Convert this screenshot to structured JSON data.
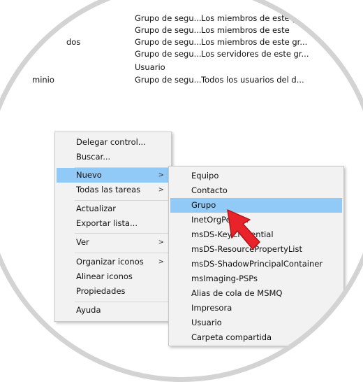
{
  "background_rows": [
    {
      "c1": "",
      "c2": "Grupo de segu...",
      "c3": "Los miembros de este gr..."
    },
    {
      "c1": "",
      "c2": "Grupo de segu...",
      "c3": "Los miembros de este"
    },
    {
      "c1": "dos",
      "c2": "Grupo de segu...",
      "c3": "Los miembros de este gr..."
    },
    {
      "c1": "",
      "c2": "Grupo de segu...",
      "c3": "Los servidores de este gr..."
    },
    {
      "c1": "",
      "c2": "Usuario",
      "c3": ""
    },
    {
      "c1": "minio",
      "c2": "Grupo de segu...",
      "c3": "Todos los usuarios del d..."
    }
  ],
  "context_menu": {
    "items": [
      {
        "label": "Delegar control...",
        "arrow": ""
      },
      {
        "label": "Buscar...",
        "arrow": ""
      },
      {
        "label": "Nuevo",
        "arrow": ">"
      },
      {
        "label": "Todas las tareas",
        "arrow": ">"
      },
      {
        "label": "Actualizar",
        "arrow": ""
      },
      {
        "label": "Exportar lista...",
        "arrow": ""
      },
      {
        "label": "Ver",
        "arrow": ">"
      },
      {
        "label": "Organizar iconos",
        "arrow": ">"
      },
      {
        "label": "Alinear iconos",
        "arrow": ""
      },
      {
        "label": "Propiedades",
        "arrow": ""
      },
      {
        "label": "Ayuda",
        "arrow": ""
      }
    ]
  },
  "submenu": {
    "items": [
      "Equipo",
      "Contacto",
      "Grupo",
      "InetOrgPerson",
      "msDS-KeyCredential",
      "msDS-ResourcePropertyList",
      "msDS-ShadowPrincipalContainer",
      "msImaging-PSPs",
      "Alias de cola de MSMQ",
      "Impresora",
      "Usuario",
      "Carpeta compartida"
    ]
  },
  "colors": {
    "highlight": "#91c9f7",
    "arrow_pointer": "#e8242a"
  }
}
